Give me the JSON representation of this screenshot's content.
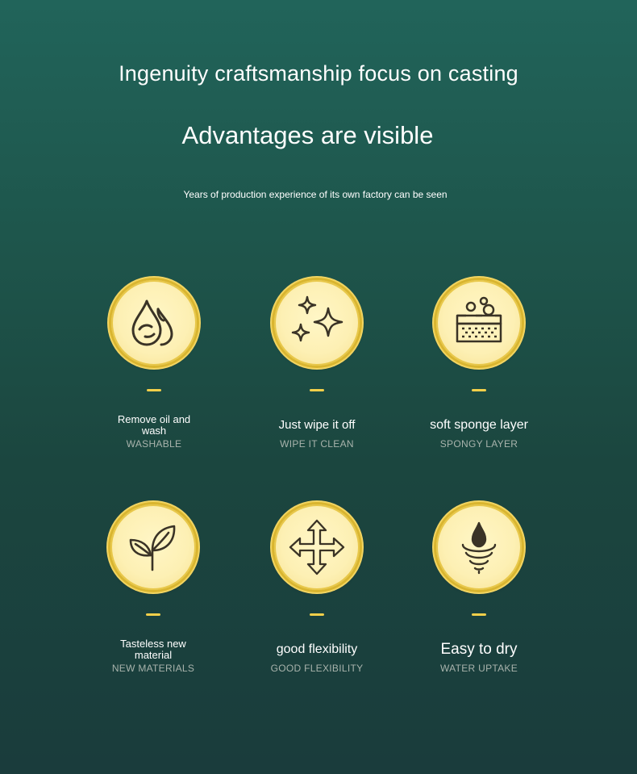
{
  "header": {
    "title": "Ingenuity craftsmanship focus on casting",
    "headline": "Advantages are visible",
    "subtitle": "Years of production experience of its own factory can be seen"
  },
  "features": [
    {
      "icon": "water-drops-icon",
      "label": "Remove oil and wash",
      "sub": "WASHABLE"
    },
    {
      "icon": "sparkle-icon",
      "label": "Just wipe it off",
      "sub": "WIPE IT CLEAN"
    },
    {
      "icon": "sponge-icon",
      "label": "soft sponge layer",
      "sub": "SPONGY LAYER"
    },
    {
      "icon": "leaf-sprout-icon",
      "label": "Tasteless new material",
      "sub": "NEW MATERIALS"
    },
    {
      "icon": "four-way-arrows-icon",
      "label": "good flexibility",
      "sub": "GOOD FLEXIBILITY"
    },
    {
      "icon": "drop-swirl-icon",
      "label": "Easy to dry",
      "sub": "WATER UPTAKE"
    }
  ],
  "colors": {
    "background_top": "#21645a",
    "background_bottom": "#1a3c3c",
    "medal_gold": "#d9b52f",
    "medal_face": "#fdf0b4",
    "icon_stroke": "#3a3326",
    "dash": "#f2cf4a",
    "sub_text": "#a8b3ac"
  }
}
